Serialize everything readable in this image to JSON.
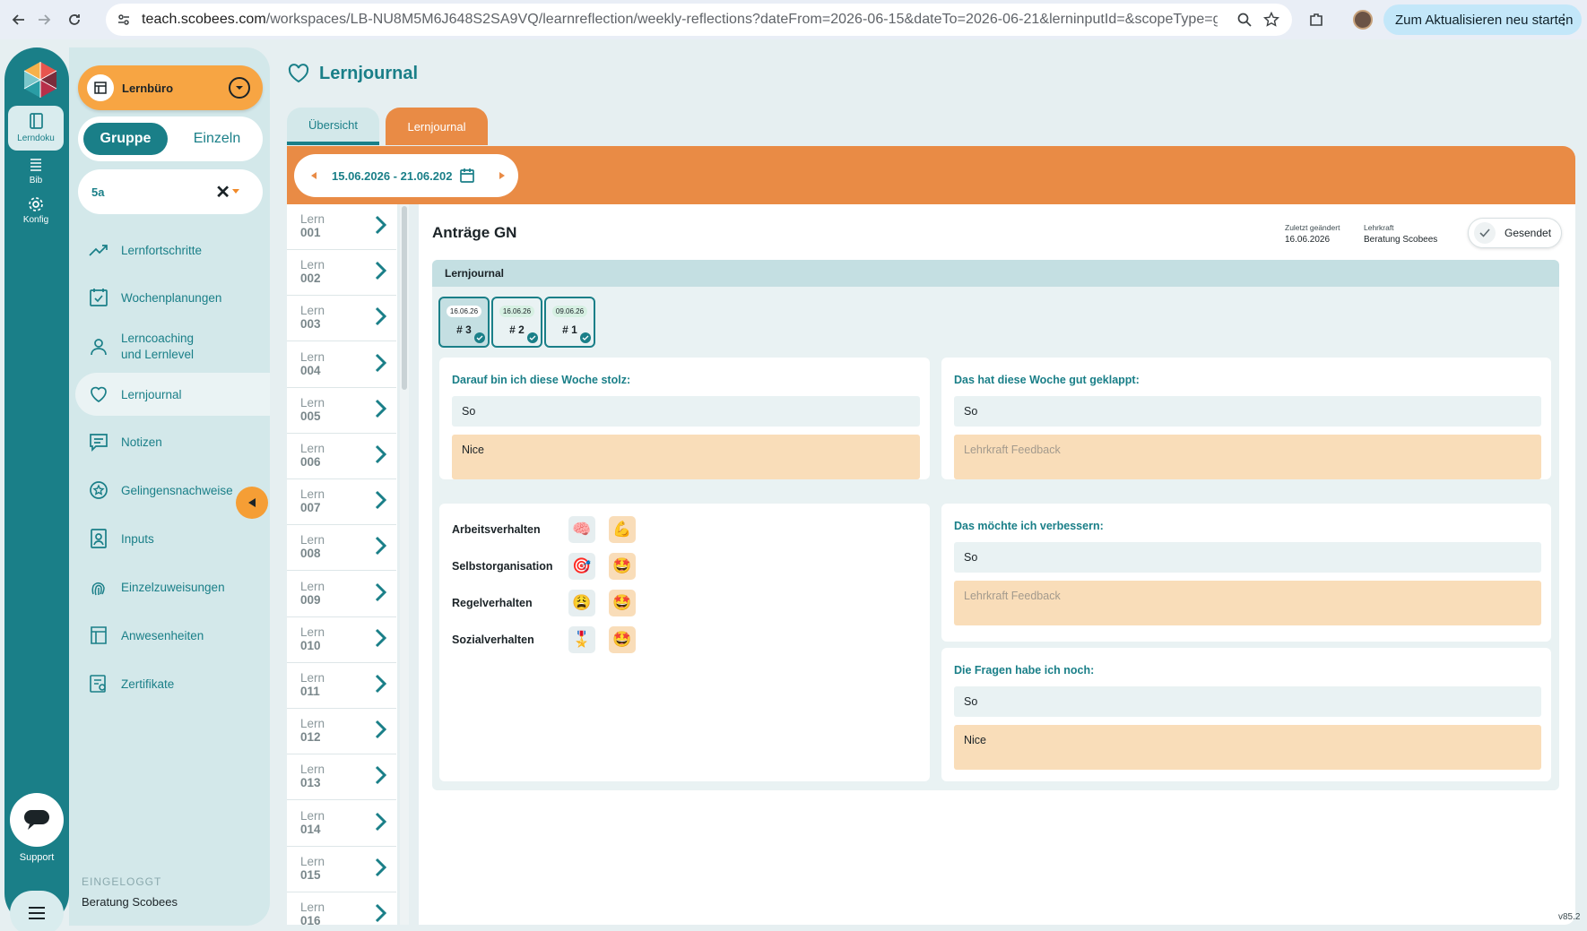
{
  "browser": {
    "url_host": "teach.scobees.com",
    "url_path": "/workspaces/LB-NU8M5M6J648S2SA9VQ/learnreflection/weekly-reflections?dateFrom=2026-06-15&dateTo=2026-06-21&lerninputId=&scopeType=group&scop...",
    "update_button": "Zum Aktualisieren neu starten"
  },
  "rail": {
    "items": [
      {
        "label": "Lerndoku",
        "icon": "notebook-icon"
      },
      {
        "label": "Bib",
        "icon": "library-icon"
      },
      {
        "label": "Konfig",
        "icon": "gear-icon"
      }
    ],
    "support_label": "Support"
  },
  "sidebar": {
    "room_name": "Lernbüro",
    "scope_group": "Gruppe",
    "scope_single": "Einzeln",
    "class_value": "5a",
    "nav": [
      {
        "label": "Lernfortschritte",
        "icon": "trend-icon"
      },
      {
        "label": "Wochenplanungen",
        "icon": "calendar-check-icon"
      },
      {
        "label": "Lerncoaching und Lernlevel",
        "icon": "coaching-icon"
      },
      {
        "label": "Lernjournal",
        "icon": "heart-icon"
      },
      {
        "label": "Notizen",
        "icon": "note-icon"
      },
      {
        "label": "Gelingensnachweise",
        "icon": "star-badge-icon"
      },
      {
        "label": "Inputs",
        "icon": "inputs-icon"
      },
      {
        "label": "Einzelzuweisungen",
        "icon": "fingerprint-icon"
      },
      {
        "label": "Anwesenheiten",
        "icon": "attendance-icon"
      },
      {
        "label": "Zertifikate",
        "icon": "certificate-icon"
      }
    ],
    "logged_in_label": "EINGELOGGT",
    "user_name": "Beratung Scobees"
  },
  "main": {
    "page_title": "Lernjournal",
    "tabs": [
      "Übersicht",
      "Lernjournal"
    ],
    "date_range": "15.06.2026 - 21.06.202",
    "students": [
      {
        "l1": "Lern",
        "l2": "001"
      },
      {
        "l1": "Lern",
        "l2": "002"
      },
      {
        "l1": "Lern",
        "l2": "003"
      },
      {
        "l1": "Lern",
        "l2": "004"
      },
      {
        "l1": "Lern",
        "l2": "005"
      },
      {
        "l1": "Lern",
        "l2": "006"
      },
      {
        "l1": "Lern",
        "l2": "007"
      },
      {
        "l1": "Lern",
        "l2": "008"
      },
      {
        "l1": "Lern",
        "l2": "009"
      },
      {
        "l1": "Lern",
        "l2": "010"
      },
      {
        "l1": "Lern",
        "l2": "011"
      },
      {
        "l1": "Lern",
        "l2": "012"
      },
      {
        "l1": "Lern",
        "l2": "013"
      },
      {
        "l1": "Lern",
        "l2": "014"
      },
      {
        "l1": "Lern",
        "l2": "015"
      },
      {
        "l1": "Lern",
        "l2": "016"
      }
    ]
  },
  "detail": {
    "title": "Anträge GN",
    "last_changed_label": "Zuletzt geändert",
    "last_changed_value": "16.06.2026",
    "teacher_label": "Lehrkraft",
    "teacher_value": "Beratung Scobees",
    "sent_label": "Gesendet",
    "panel_title": "Lernjournal",
    "entries": [
      {
        "date": "16.06.26",
        "num": "# 3"
      },
      {
        "date": "16.06.26",
        "num": "# 2"
      },
      {
        "date": "09.06.26",
        "num": "# 1"
      }
    ],
    "proud": {
      "question": "Darauf bin ich diese Woche stolz:",
      "answer": "So",
      "feedback": "Nice"
    },
    "went_well": {
      "question": "Das hat diese Woche gut geklappt:",
      "answer": "So",
      "feedback_placeholder": "Lehrkraft Feedback"
    },
    "improve": {
      "question": "Das möchte ich verbessern:",
      "answer": "So",
      "feedback_placeholder": "Lehrkraft Feedback"
    },
    "questions": {
      "question": "Die Fragen habe ich noch:",
      "answer": "So",
      "feedback": "Nice"
    },
    "behaviour": [
      {
        "label": "Arbeitsverhalten",
        "student": "🧠",
        "teacher": "💪"
      },
      {
        "label": "Selbstorganisation",
        "student": "🎯",
        "teacher": "🤩"
      },
      {
        "label": "Regelverhalten",
        "student": "😩",
        "teacher": "🤩"
      },
      {
        "label": "Sozialverhalten",
        "student": "🎖️",
        "teacher": "🤩"
      }
    ]
  },
  "version": "v85.2",
  "colors": {
    "teal": "#1a7f88",
    "orange": "#e98b45",
    "light_teal": "#d3e8ea",
    "feedback": "#f9ddb9"
  }
}
